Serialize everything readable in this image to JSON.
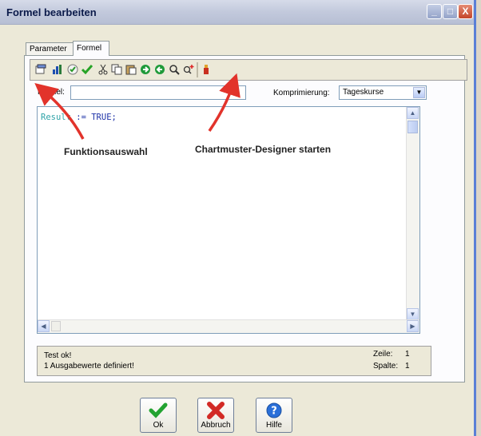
{
  "window": {
    "title": "Formel bearbeiten",
    "controls": {
      "minimize": "_",
      "maximize": "□",
      "close": "X"
    }
  },
  "tabs": [
    {
      "label": "Parameter",
      "active": false
    },
    {
      "label": "Formel",
      "active": true
    }
  ],
  "toolbar": {
    "icons": [
      "properties-icon",
      "chart-icon",
      "check-circle-icon",
      "checkmark-icon",
      "cut-icon",
      "copy-icon",
      "paste-icon",
      "forward-icon",
      "back-icon",
      "search-icon",
      "search-replace-icon",
      "designer-icon"
    ]
  },
  "form": {
    "formel_label": "Formel:",
    "formel_value": "",
    "komprimierung_label": "Komprimierung:",
    "komprimierung_value": "Tageskurse"
  },
  "editor": {
    "code_keyword": "Result",
    "code_rest": " := TRUE;"
  },
  "annotations": {
    "funktionsauswahl": "Funktionsauswahl",
    "chartmuster": "Chartmuster-Designer starten"
  },
  "status": {
    "line1": "Test ok!",
    "line2": "1 Ausgabewerte definiert!",
    "zeile_label": "Zeile:",
    "zeile_value": "1",
    "spalte_label": "Spalte:",
    "spalte_value": "1"
  },
  "buttons": {
    "ok": "Ok",
    "abbruch": "Abbruch",
    "hilfe": "Hilfe"
  },
  "colors": {
    "arrow": "#e2332b",
    "code_keyword": "#2fa3a8",
    "code_text": "#1f33a8"
  }
}
